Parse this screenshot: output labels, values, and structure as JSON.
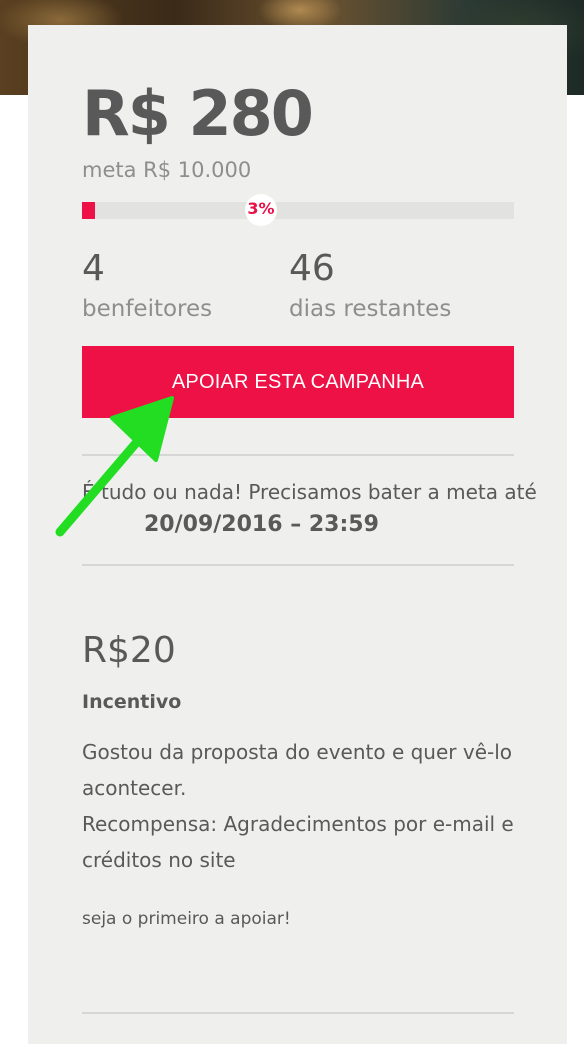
{
  "campaign": {
    "raised": "R$ 280",
    "goal_text": "meta R$ 10.000",
    "progress_percent": 3,
    "progress_label": "3%",
    "backers_count": "4",
    "backers_label": "benfeitores",
    "days_left_count": "46",
    "days_left_label": "dias restantes",
    "support_button_label": "APOIAR ESTA CAMPANHA",
    "deadline_text": "É tudo ou nada! Precisamos bater a meta até",
    "deadline_date": "20/09/2016 – 23:59"
  },
  "reward": {
    "price": "R$20",
    "title": "Incentivo",
    "description_lines": [
      "Gostou da proposta do evento e quer vê-lo",
      "acontecer.",
      "Recompensa: Agradecimentos por e-mail e",
      "créditos no site"
    ],
    "cta_text": "seja o primeiro a apoiar!"
  },
  "colors": {
    "accent": "#ee1146",
    "panel_bg": "#eff0ee",
    "text_dark": "#595959",
    "text_muted": "#8e8e8e",
    "annotation_arrow": "#22dd22"
  },
  "icons": {
    "annotation": "green-arrow-icon"
  }
}
